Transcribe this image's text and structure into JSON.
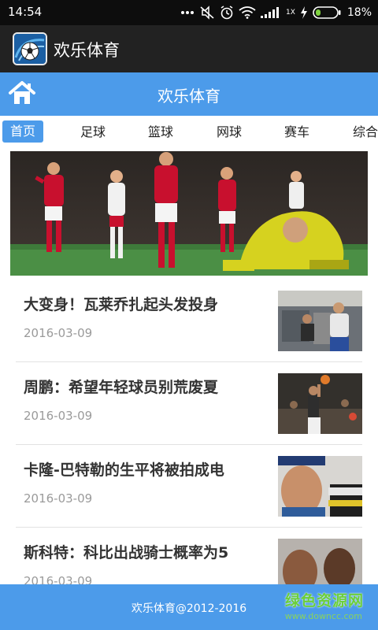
{
  "status_bar": {
    "time": "14:54",
    "network_speed": "1X",
    "battery": "18%",
    "icons": [
      "dots-icon",
      "mute-icon",
      "alarm-icon",
      "wifi-icon",
      "signal-icon",
      "charging-icon",
      "battery-icon"
    ]
  },
  "app_bar": {
    "title": "欢乐体育",
    "logo_icon": "soccer-ball-logo-icon"
  },
  "header": {
    "title": "欢乐体育",
    "home_icon": "home-icon"
  },
  "tabs": [
    {
      "label": "首页",
      "active": true
    },
    {
      "label": "足球",
      "active": false
    },
    {
      "label": "篮球",
      "active": false
    },
    {
      "label": "网球",
      "active": false
    },
    {
      "label": "赛车",
      "active": false
    },
    {
      "label": "综合",
      "active": false
    }
  ],
  "news": [
    {
      "title": "大变身！瓦莱乔扎起头发投身",
      "date": "2016-03-09"
    },
    {
      "title": "周鹏：希望年轻球员别荒废夏",
      "date": "2016-03-09"
    },
    {
      "title": "卡隆-巴特勒的生平将被拍成电",
      "date": "2016-03-09"
    },
    {
      "title": "斯科特：科比出战骑士概率为5",
      "date": "2016-03-09"
    }
  ],
  "footer": {
    "text": "欢乐体育@2012-2016"
  },
  "watermark": {
    "line1": "绿色资源网",
    "line2": "www.downcc.com"
  },
  "colors": {
    "accent_blue": "#4c9bea",
    "title_bar": "#222222",
    "status_bar": "#0d0d0d"
  }
}
